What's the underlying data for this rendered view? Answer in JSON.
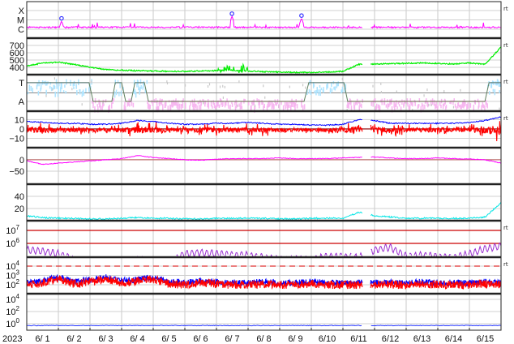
{
  "chart_data": {
    "type": "line",
    "title": "",
    "xlabel": "",
    "x_unit": "days since 2023-06-01 00:00",
    "xlim": [
      0,
      15
    ],
    "year_label": "2023",
    "day_labels": [
      "6/ 1",
      "6/ 2",
      "6/ 3",
      "6/ 4",
      "6/ 5",
      "6/ 6",
      "6/ 7",
      "6/ 8",
      "6/ 9",
      "6/10",
      "6/11",
      "6/12",
      "6/13",
      "6/14",
      "6/15"
    ],
    "rt_label": "rt",
    "grid": true,
    "sample_step_days": 0.5,
    "gaps": [
      [
        10.62,
        10.87
      ]
    ],
    "panels": [
      {
        "id": "xray",
        "scale": "log",
        "ylim": [
          -6.96,
          -3.04
        ],
        "rt": true,
        "ticks": [
          {
            "v": -4,
            "label": "X"
          },
          {
            "v": -5,
            "label": "M"
          },
          {
            "v": -6,
            "label": "C"
          }
        ],
        "series": [
          {
            "name": "xray-flux",
            "color": "#ff00ff",
            "baseline_log": -5.8,
            "noise": 0.08,
            "flares": [
              {
                "day": 1.1,
                "peak_log": -5.1
              },
              {
                "day": 6.49,
                "peak_log": -4.6
              },
              {
                "day": 8.69,
                "peak_log": -4.8
              }
            ],
            "marker_color": "#3333ff"
          }
        ]
      },
      {
        "id": "wind-speed",
        "scale": "linear",
        "ylim": [
          300,
          800
        ],
        "rt": true,
        "ticks": [
          {
            "v": 700,
            "label": "700"
          },
          {
            "v": 600,
            "label": "600"
          },
          {
            "v": 500,
            "label": "500"
          },
          {
            "v": 400,
            "label": "400"
          }
        ],
        "series": [
          {
            "name": "speed",
            "color": "#00ee00",
            "noise": 8,
            "burst": [
              6.05,
              7.0
            ],
            "values": [
              420,
              460,
              470,
              440,
              400,
              370,
              360,
              355,
              350,
              345,
              345,
              350,
              355,
              360,
              350,
              340,
              335,
              330,
              330,
              335,
              345,
              440,
              445,
              450,
              455,
              460,
              455,
              445,
              460,
              440,
              680
            ]
          }
        ]
      },
      {
        "id": "mag-sector",
        "scale": "category",
        "ylim": [
          -0.52,
          1.43
        ],
        "rt": true,
        "ticks": [
          {
            "v": 1,
            "label": "T"
          },
          {
            "v": 0,
            "label": "A"
          }
        ],
        "series": [
          {
            "name": "sector-state",
            "color": "#5f7f5f",
            "steps": [
              [
                0,
                1
              ],
              [
                1.97,
                1
              ],
              [
                2.1,
                0
              ],
              [
                2.69,
                0
              ],
              [
                2.8,
                1
              ],
              [
                3.0,
                1
              ],
              [
                3.13,
                0
              ],
              [
                3.3,
                0
              ],
              [
                3.42,
                1
              ],
              [
                3.72,
                1
              ],
              [
                3.85,
                0
              ],
              [
                8.77,
                0
              ],
              [
                8.92,
                1
              ],
              [
                10.03,
                1
              ],
              [
                10.15,
                0
              ],
              [
                14.49,
                0
              ],
              [
                14.62,
                1
              ],
              [
                15,
                1
              ]
            ]
          },
          {
            "name": "toward-scatter",
            "color": "#aee4ff"
          },
          {
            "name": "away-scatter",
            "color": "#f7b6f0"
          }
        ]
      },
      {
        "id": "imf",
        "scale": "linear",
        "ylim": [
          -20,
          19
        ],
        "rt": true,
        "ticks": [
          {
            "v": 10,
            "label": "10"
          },
          {
            "v": 0,
            "label": "0"
          },
          {
            "v": -10,
            "label": "−10"
          }
        ],
        "ref_lines": [
          {
            "v": 0,
            "color": "#8b0000"
          }
        ],
        "series": [
          {
            "name": "bt",
            "color": "#0000ff",
            "values": [
              8,
              7,
              6,
              6,
              5,
              5,
              6,
              9,
              8,
              6,
              5,
              5,
              6,
              6,
              7,
              6,
              5,
              5,
              4,
              4,
              5,
              10,
              9,
              6,
              6,
              6,
              6,
              6,
              7,
              9,
              13
            ]
          },
          {
            "name": "bz",
            "color": "#ff0000",
            "mean": -1,
            "noise_factor": 0.7
          }
        ]
      },
      {
        "id": "dst",
        "scale": "linear",
        "ylim": [
          -107,
          53
        ],
        "rt": false,
        "ticks": [
          {
            "v": 0,
            "label": "0"
          },
          {
            "v": -50,
            "label": "−50"
          }
        ],
        "ref_lines": [
          {
            "v": 0,
            "color": "#c07070"
          }
        ],
        "series": [
          {
            "name": "dst",
            "color": "#ff00ff",
            "noise": 1.5,
            "values": [
              -5,
              -20,
              -15,
              -10,
              -5,
              0,
              5,
              18,
              10,
              5,
              0,
              -2,
              2,
              5,
              5,
              5,
              8,
              5,
              5,
              5,
              8,
              10,
              12,
              8,
              5,
              5,
              8,
              5,
              3,
              0,
              -15
            ]
          }
        ]
      },
      {
        "id": "density",
        "scale": "linear",
        "ylim": [
          0,
          60
        ],
        "rt": false,
        "ticks": [
          {
            "v": 40,
            "label": "40"
          },
          {
            "v": 20,
            "label": "20"
          }
        ],
        "series": [
          {
            "name": "density",
            "color": "#00e5e5",
            "noise": 1.2,
            "values": [
              8,
              5,
              4,
              4,
              3,
              3,
              4,
              5,
              4,
              4,
              3,
              3,
              4,
              4,
              4,
              4,
              3,
              3,
              4,
              4,
              4,
              14,
              8,
              6,
              4,
              4,
              4,
              4,
              4,
              6,
              30
            ]
          }
        ]
      },
      {
        "id": "electrons",
        "scale": "log",
        "ylim": [
          4.94,
          7.75
        ],
        "rt": true,
        "ticks": [
          {
            "v": 7,
            "label": "10",
            "exp": "7"
          },
          {
            "v": 6,
            "label": "10",
            "exp": "6"
          }
        ],
        "ref_lines": [
          {
            "v": 7,
            "color": "#cc0000"
          },
          {
            "v": 6,
            "color": "#cc0000"
          }
        ],
        "series": [
          {
            "name": "electron-flux",
            "color": "#9b30d0",
            "noise": 0.25,
            "values": [
              5.5,
              5.4,
              5.2,
              4.8,
              4.7,
              4.6,
              4.7,
              4.8,
              4.7,
              4.6,
              5.2,
              5.3,
              5.2,
              5.1,
              5.1,
              4.9,
              4.8,
              4.8,
              4.8,
              5.0,
              5.0,
              4.9,
              5.5,
              5.7,
              5.0,
              5.1,
              5.0,
              4.9,
              5.2,
              5.6,
              5.8
            ]
          }
        ]
      },
      {
        "id": "protons",
        "scale": "log",
        "ylim": [
          1.04,
          4.96
        ],
        "rt": true,
        "ticks": [
          {
            "v": 4,
            "label": "10",
            "exp": "4"
          },
          {
            "v": 3,
            "label": "10",
            "exp": "3"
          },
          {
            "v": 2,
            "label": "10",
            "exp": "2"
          }
        ],
        "ref_lines": [
          {
            "v": 4,
            "color": "#e03030",
            "dashed": true
          }
        ],
        "series": [
          {
            "name": "proton-high",
            "color": "#0000ff",
            "noise": 0.35,
            "values": [
              2.2,
              2.4,
              2.8,
              2.3,
              2.5,
              2.8,
              2.4,
              2.6,
              2.8,
              2.3,
              2.2,
              2.4,
              2.3,
              2.2,
              2.2,
              2.3,
              2.2,
              2.2,
              2.3,
              2.2,
              2.2,
              2.2,
              2.2,
              2.2,
              2.2,
              2.3,
              2.2,
              2.2,
              2.2,
              2.3,
              2.2
            ]
          },
          {
            "name": "proton-low",
            "color": "#ff0000",
            "offset": -0.2,
            "noise": 0.45
          }
        ]
      },
      {
        "id": "high-energy",
        "scale": "log",
        "ylim": [
          -1.07,
          4.93
        ],
        "rt": false,
        "ticks": [
          {
            "v": 4,
            "label": "10",
            "exp": "4"
          },
          {
            "v": 2,
            "label": "10",
            "exp": "2"
          },
          {
            "v": 0,
            "label": "10",
            "exp": "0"
          }
        ],
        "series": [
          {
            "name": "high-energy-flux",
            "color": "#2233ff",
            "level": -0.3,
            "noise": 0.05
          }
        ]
      }
    ]
  }
}
